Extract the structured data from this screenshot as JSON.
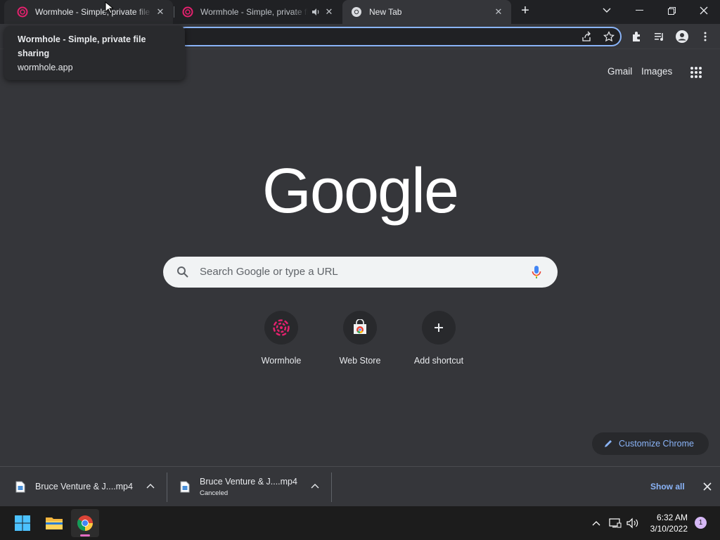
{
  "browser": {
    "tabs": [
      {
        "title": "Wormhole - Simple, private file sharing",
        "state": "hovered"
      },
      {
        "title": "Wormhole - Simple, private file sharing",
        "state": "audio"
      },
      {
        "title": "New Tab",
        "state": "active"
      }
    ],
    "tooltip": {
      "title": "Wormhole - Simple, private file sharing",
      "url": "wormhole.app"
    },
    "omnibox": {
      "value": ""
    }
  },
  "ntp": {
    "top_links": {
      "gmail": "Gmail",
      "images": "Images"
    },
    "logo_text": "Google",
    "search_placeholder": "Search Google or type a URL",
    "shortcuts": [
      {
        "label": "Wormhole",
        "icon": "wormhole-icon"
      },
      {
        "label": "Web Store",
        "icon": "web-store-icon"
      },
      {
        "label": "Add shortcut",
        "icon": "plus-icon"
      }
    ],
    "customize_label": "Customize Chrome"
  },
  "downloads": {
    "items": [
      {
        "name": "Bruce Venture & J....mp4",
        "status": ""
      },
      {
        "name": "Bruce Venture & J....mp4",
        "status": "Canceled"
      }
    ],
    "show_all": "Show all"
  },
  "taskbar": {
    "time": "6:32 AM",
    "date": "3/10/2022",
    "notification_count": "1"
  },
  "colors": {
    "accent": "#8ab4f8",
    "background": "#35363a",
    "tabstrip": "#202124",
    "wormhole_brand": "#e5216e"
  }
}
